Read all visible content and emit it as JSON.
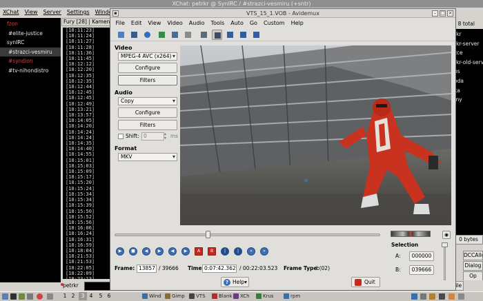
{
  "xchat": {
    "title": "XChat: petrkr @ SynIRC / #strazci-vesmiru (+sntr)",
    "menu": [
      "XChat",
      "View",
      "Server",
      "Settings",
      "Window"
    ],
    "tree": [
      {
        "label": "fzon",
        "style": "red",
        "indent": "i0"
      },
      {
        "label": "#elite-justice",
        "style": "",
        "indent": "i1"
      },
      {
        "label": "synIRC",
        "style": "",
        "indent": "i0"
      },
      {
        "label": "#strazci-vesmiru",
        "style": "hl",
        "indent": "i1"
      },
      {
        "label": "#syndion",
        "style": "red",
        "indent": "i1"
      },
      {
        "label": "#tv-nihondistro",
        "style": "",
        "indent": "i1"
      }
    ],
    "topic": "Fury [28] | Kamen",
    "timestamps": [
      "[18:11:23]",
      "[18:11:24]",
      "[18:11:27]",
      "[18:11:28]",
      "[18:11:36]",
      "[18:11:45]",
      "[18:12:12]",
      "[18:12:20]",
      "[18:12:35]",
      "[18:12:35]",
      "[18:12:44]",
      "[18:12:45]",
      "[18:12:45]",
      "[18:12:49]",
      "[18:13:21]",
      "[18:13:57]",
      "[18:14:05]",
      "[18:14:20]",
      "[18:14:24]",
      "[18:14:24]",
      "[18:14:35]",
      "[18:14:40]",
      "[18:14:55]",
      "[18:15:01]",
      "[18:15:03]",
      "[18:15:09]",
      "[18:15:17]",
      "[18:15:20]",
      "[18:15:24]",
      "[18:15:34]",
      "[18:15:34]",
      "[18:15:39]",
      "[18:15:50]",
      "[18:15:52]",
      "[18:15:56]",
      "[18:16:06]",
      "[18:16:24]",
      "[18:16:31]",
      "[18:16:59]",
      "[18:18:04]",
      "[18:21:53]",
      "[18:21:53]",
      "[18:22:05]",
      "[18:22:09]",
      "[18:23:13]"
    ],
    "users_count": "s, 8 total",
    "users": [
      "rkr",
      "rkr-server",
      "zce",
      "rkr-old-serve",
      "ps",
      "oda",
      "ka",
      "my"
    ],
    "side_buttons": {
      "bytes": "0 bytes",
      "dccallow": "DCCAllo",
      "dialog": "Dialog",
      "op": "Op"
    },
    "nick": "petrkr",
    "sendfile": "Sendfile"
  },
  "taskbar": {
    "workspaces": [
      "1",
      "2",
      "3",
      "4",
      "5",
      "6"
    ],
    "tasks": [
      {
        "label": "Wind",
        "color": "#3a6ea5"
      },
      {
        "label": "Gimp",
        "color": "#8a6b3b"
      },
      {
        "label": "VTS",
        "color": "#444444"
      },
      {
        "label": "Blank",
        "color": "#b03030"
      },
      {
        "label": "XCh",
        "color": "#6b3b8a"
      },
      {
        "label": "Krus",
        "color": "#3b7a3b"
      },
      {
        "label": "rpm",
        "color": "#3a6ea5"
      }
    ]
  },
  "avidemux": {
    "title": "VTS_15_1.VOB - Avidemux",
    "menu": [
      "File",
      "Edit",
      "View",
      "Video",
      "Audio",
      "Tools",
      "Auto",
      "Go",
      "Custom",
      "Help"
    ],
    "toolbar_icons": [
      "open-icon",
      "save-icon",
      "info-icon",
      "save-image-icon",
      "save-jpeg-icon",
      "calculator-icon",
      "forward-icon",
      "forward-selected-icon",
      "preview-icon",
      "display-icon",
      "output-icon"
    ],
    "video": {
      "label": "Video",
      "codec": "MPEG-4 AVC (x264)",
      "configure": "Configure",
      "filters": "Filters"
    },
    "audio": {
      "label": "Audio",
      "codec": "Copy",
      "configure": "Configure",
      "filters": "Filters",
      "shift_label": "Shift:",
      "shift_value": "0",
      "shift_unit": "ms"
    },
    "format": {
      "label": "Format",
      "value": "MKV"
    },
    "seek_fraction": 0.35,
    "status": {
      "frame_label": "Frame:",
      "frame_value": "13857",
      "frame_total": "/ 39666",
      "time_label": "Time:",
      "time_value": "0:07:42.362",
      "time_total": "/ 00:22:03.523",
      "frame_type_label": "Frame Type:",
      "frame_type_value": "I (02)"
    },
    "selection": {
      "label": "Selection",
      "a_label": "A:",
      "a_value": "000000",
      "b_label": "B:",
      "b_value": "039666"
    },
    "help_label": "Help",
    "quit_label": "Quit"
  }
}
